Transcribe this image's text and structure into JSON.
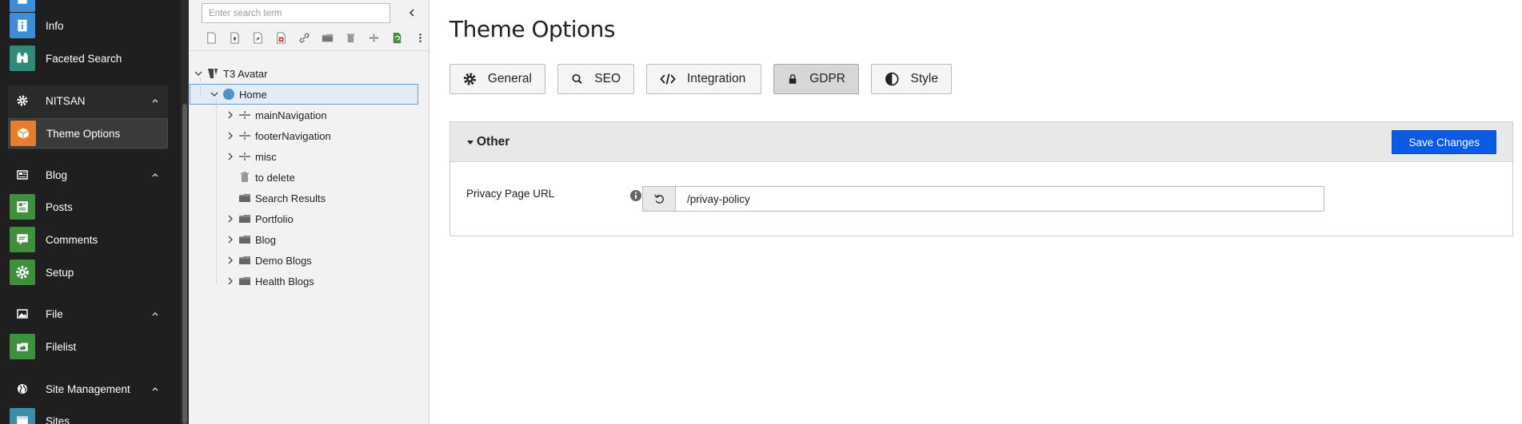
{
  "module_menu": {
    "items": [
      {
        "label": "Info",
        "icon": "info-icon",
        "color": "#3d8ed6"
      },
      {
        "label": "Faceted Search",
        "icon": "binoculars-icon",
        "color": "#2f8a7a"
      },
      {
        "label": "Theme Options",
        "icon": "cube-icon",
        "color": "#e77d2c"
      },
      {
        "label": "Posts",
        "icon": "posts-icon",
        "color": "#3f8f3f"
      },
      {
        "label": "Comments",
        "icon": "comment-icon",
        "color": "#3f8f3f"
      },
      {
        "label": "Setup",
        "icon": "gear-icon",
        "color": "#3f8f3f"
      },
      {
        "label": "Filelist",
        "icon": "folder-cloud-icon",
        "color": "#3f8f3f"
      },
      {
        "label": "Sites",
        "icon": "sites-icon",
        "color": "#3a8ea6"
      }
    ],
    "groups": [
      {
        "label": "NITSAN",
        "icon": "gear-icon"
      },
      {
        "label": "Blog",
        "icon": "news-icon"
      },
      {
        "label": "File",
        "icon": "image-icon"
      },
      {
        "label": "Site Management",
        "icon": "globe-icon"
      }
    ]
  },
  "page_tree": {
    "search_placeholder": "Enter search term",
    "root": "T3 Avatar",
    "home": "Home",
    "children": [
      {
        "label": "mainNavigation",
        "icon": "separator-icon",
        "expandable": true
      },
      {
        "label": "footerNavigation",
        "icon": "separator-icon",
        "expandable": true
      },
      {
        "label": "misc",
        "icon": "separator-icon",
        "expandable": true
      },
      {
        "label": "to delete",
        "icon": "trash-icon",
        "expandable": false
      },
      {
        "label": "Search Results",
        "icon": "folder-icon",
        "expandable": false
      },
      {
        "label": "Portfolio",
        "icon": "folder-icon",
        "expandable": true
      },
      {
        "label": "Blog",
        "icon": "folder-icon",
        "expandable": true
      },
      {
        "label": "Demo Blogs",
        "icon": "folder-icon",
        "expandable": true
      },
      {
        "label": "Health Blogs",
        "icon": "folder-icon",
        "expandable": true
      }
    ]
  },
  "main": {
    "title": "Theme Options",
    "tabs": [
      {
        "label": "General",
        "icon": "gear-icon",
        "active": false
      },
      {
        "label": "SEO",
        "icon": "search-icon",
        "active": false
      },
      {
        "label": "Integration",
        "icon": "code-icon",
        "active": false
      },
      {
        "label": "GDPR",
        "icon": "lock-icon",
        "active": true
      },
      {
        "label": "Style",
        "icon": "contrast-icon",
        "active": false
      }
    ],
    "panel": {
      "title": "Other",
      "save_label": "Save Changes",
      "field_label": "Privacy Page URL",
      "field_value": "/privay-policy"
    }
  },
  "colors": {
    "accent": "#0b5ae3",
    "menu_bg": "#1f1f1f"
  }
}
